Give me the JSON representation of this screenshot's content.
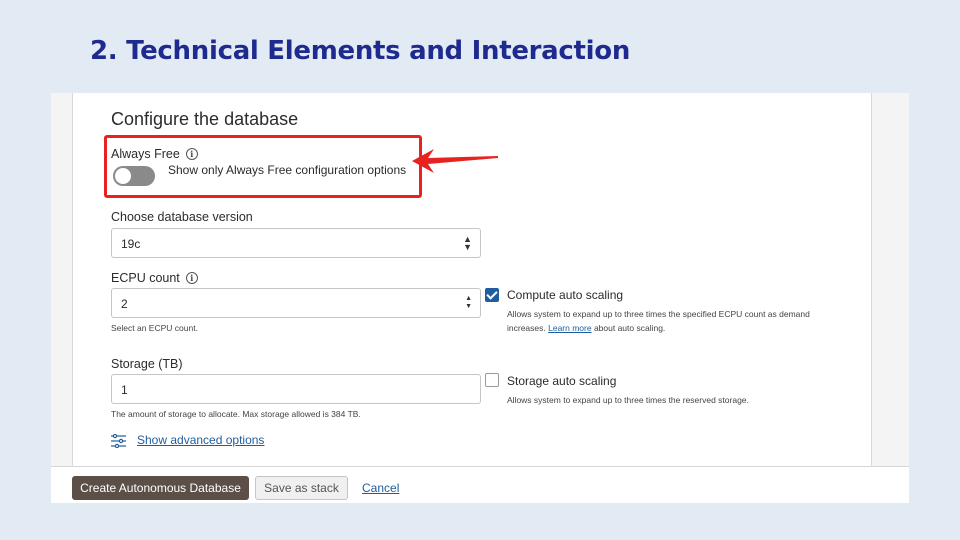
{
  "slide": {
    "title": "2. Technical Elements and Interaction"
  },
  "form": {
    "heading": "Configure the database",
    "always_free": {
      "label": "Always Free",
      "toggle_text": "Show only Always Free configuration options",
      "enabled": false
    },
    "db_version": {
      "label": "Choose database version",
      "value": "19c"
    },
    "ecpu": {
      "label": "ECPU count",
      "value": "2",
      "hint": "Select an ECPU count."
    },
    "compute_scaling": {
      "label": "Compute auto scaling",
      "checked": true,
      "desc_line1": "Allows system to expand up to three times the specified ECPU count as demand",
      "desc_line2_pre": "increases. ",
      "desc_link": "Learn more",
      "desc_line2_post": " about auto scaling."
    },
    "storage": {
      "label": "Storage (TB)",
      "value": "1",
      "hint": "The amount of storage to allocate. Max storage allowed is 384 TB."
    },
    "storage_scaling": {
      "label": "Storage auto scaling",
      "checked": false,
      "desc": "Allows system to expand up to three times the reserved storage."
    },
    "advanced_link": "Show advanced options",
    "info_icon_glyph": "i"
  },
  "footer": {
    "create_button": "Create Autonomous Database",
    "stack_button": "Save as stack",
    "cancel_link": "Cancel"
  },
  "colors": {
    "highlight": "#e8231f",
    "title": "#1f2a8f",
    "link": "#1f5d9e"
  }
}
